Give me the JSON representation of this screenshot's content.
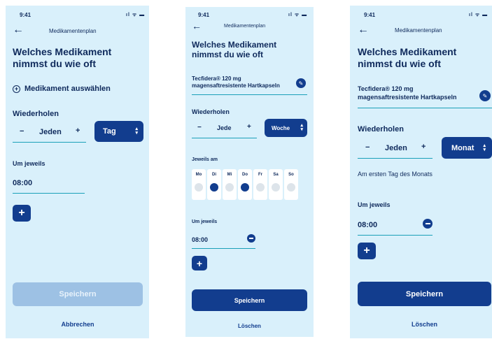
{
  "status": {
    "time": "9:41",
    "icons": "ıl ᯤ ▬"
  },
  "nav": {
    "title": "Medikamentenplan"
  },
  "heading": "Welches Medikament nimmst du wie oft",
  "screen1": {
    "add_medication": "Medikament auswählen",
    "repeat_label": "Wiederholen",
    "stepper_value": "Jeden",
    "interval": "Tag",
    "at_label": "Um jeweils",
    "time_value": "08:00",
    "save_label": "Speichern",
    "cancel_label": "Abbrechen"
  },
  "screen2": {
    "medication_line1": "Tecfidera® 120 mg",
    "medication_line2": "magensaftresistente Hartkapseln",
    "repeat_label": "Wiederholen",
    "stepper_value": "Jede",
    "interval": "Woche",
    "days_label": "Jeweils am",
    "days": [
      {
        "label": "Mo",
        "selected": false
      },
      {
        "label": "Di",
        "selected": true
      },
      {
        "label": "Mi",
        "selected": false
      },
      {
        "label": "Do",
        "selected": true
      },
      {
        "label": "Fr",
        "selected": false
      },
      {
        "label": "Sa",
        "selected": false
      },
      {
        "label": "So",
        "selected": false
      }
    ],
    "at_label": "Um jeweils",
    "time_value": "08:00",
    "save_label": "Speichern",
    "delete_label": "Löschen"
  },
  "screen3": {
    "medication_line1": "Tecfidera® 120 mg",
    "medication_line2": "magensaftresistente Hartkapseln",
    "repeat_label": "Wiederholen",
    "stepper_value": "Jeden",
    "interval": "Monat",
    "month_note": "Am ersten Tag des Monats",
    "at_label": "Um jeweils",
    "time_value": "08:00",
    "save_label": "Speichern",
    "delete_label": "Löschen"
  },
  "glyphs": {
    "back": "←",
    "minus": "−",
    "plus": "+",
    "add": "+",
    "pencil": "✎",
    "up": "▴",
    "down": "▾"
  }
}
